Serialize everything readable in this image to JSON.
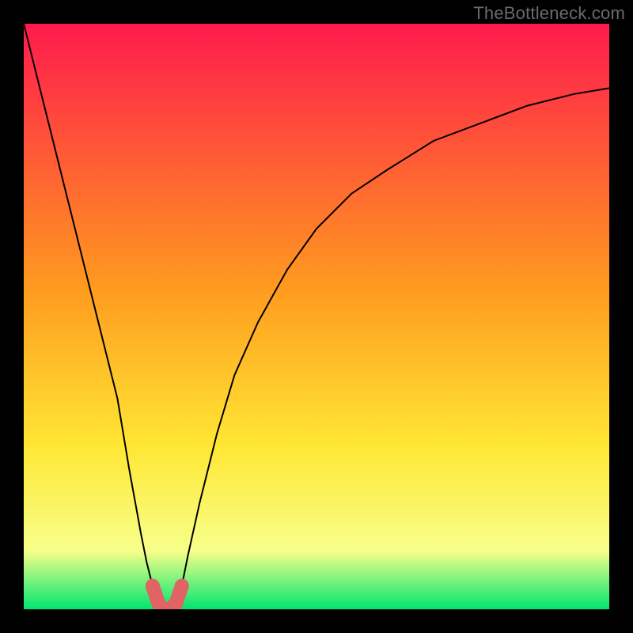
{
  "watermark": "TheBottleneck.com",
  "chart_data": {
    "type": "line",
    "title": "",
    "xlabel": "",
    "ylabel": "",
    "xlim": [
      0,
      100
    ],
    "ylim": [
      0,
      100
    ],
    "grid": false,
    "legend": null,
    "background_gradient": {
      "top": "#ff1a4d",
      "mid1": "#ff9a1f",
      "mid2": "#ffe733",
      "mid3": "#f7ff8a",
      "bottom": "#00e66f"
    },
    "series": [
      {
        "name": "bottleneck-curve",
        "color": "#000000",
        "x": [
          0,
          4,
          8,
          12,
          16,
          18,
          20,
          21,
          22,
          23,
          24,
          25,
          26,
          27,
          28,
          30,
          33,
          36,
          40,
          45,
          50,
          56,
          62,
          70,
          78,
          86,
          94,
          100
        ],
        "values": [
          100,
          84,
          68,
          52,
          36,
          24,
          13,
          8,
          4,
          1,
          0,
          0,
          1,
          4,
          9,
          18,
          30,
          40,
          49,
          58,
          65,
          71,
          75,
          80,
          83,
          86,
          88,
          89
        ]
      },
      {
        "name": "sweet-spot-marker",
        "color": "#e06464",
        "type": "scatter",
        "x": [
          22,
          23,
          24,
          25,
          26,
          27
        ],
        "values": [
          4,
          1,
          0,
          0,
          1,
          4
        ]
      }
    ],
    "annotations": []
  }
}
